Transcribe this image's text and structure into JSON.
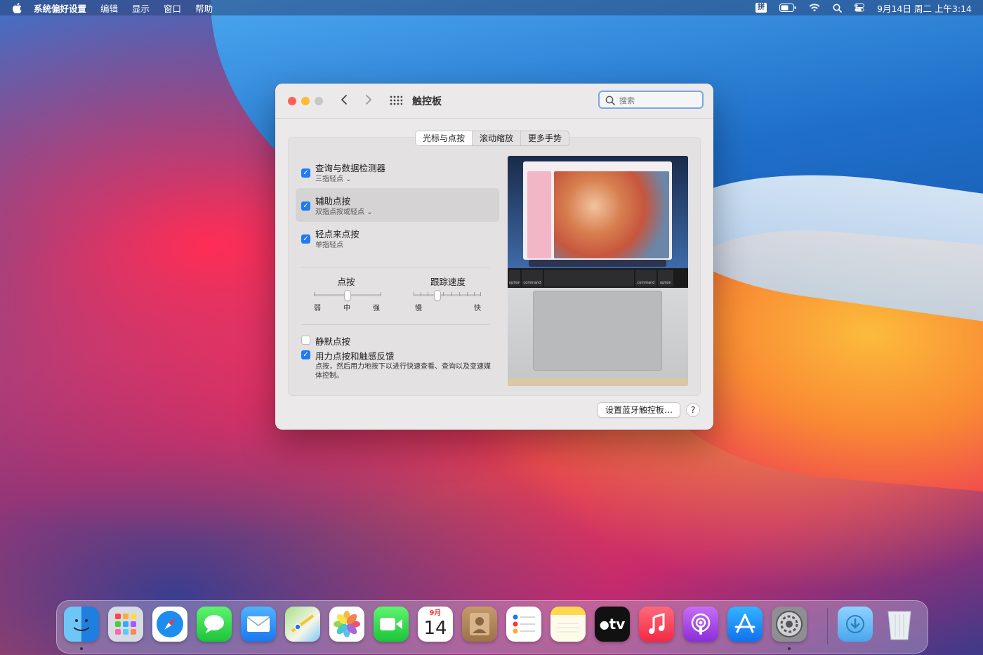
{
  "menubar": {
    "app_name": "系统偏好设置",
    "menus": [
      "编辑",
      "显示",
      "窗口",
      "帮助"
    ],
    "ime": "拼",
    "datetime": "9月14日 周二 上午3:14"
  },
  "window": {
    "title": "触控板",
    "search_placeholder": "搜索",
    "tabs": [
      "光标与点按",
      "滚动缩放",
      "更多手势"
    ],
    "options": [
      {
        "title": "查询与数据检测器",
        "subtitle": "三指轻点 ⌄",
        "checked": true
      },
      {
        "title": "辅助点按",
        "subtitle": "双指点按或轻点 ⌄",
        "checked": true
      },
      {
        "title": "轻点来点按",
        "subtitle": "单指轻点",
        "checked": true
      }
    ],
    "click_slider": {
      "title": "点按",
      "labels": [
        "弱",
        "中",
        "强"
      ],
      "value": 0.5
    },
    "tracking_slider": {
      "title": "跟踪速度",
      "labels": [
        "慢",
        "快"
      ],
      "value": 0.35
    },
    "silent_click": {
      "title": "静默点按",
      "checked": false
    },
    "force_click": {
      "title": "用力点按和触感反馈",
      "checked": true,
      "description": "点按，然后用力地按下以进行快速查看、查询以及变速媒体控制。"
    },
    "preview_keys": [
      "option",
      "command",
      "command",
      "option"
    ],
    "bt_button": "设置蓝牙触控板…",
    "help_button": "?"
  },
  "dock": {
    "calendar_month": "9月",
    "calendar_day": "14",
    "tv_label": "tv"
  }
}
